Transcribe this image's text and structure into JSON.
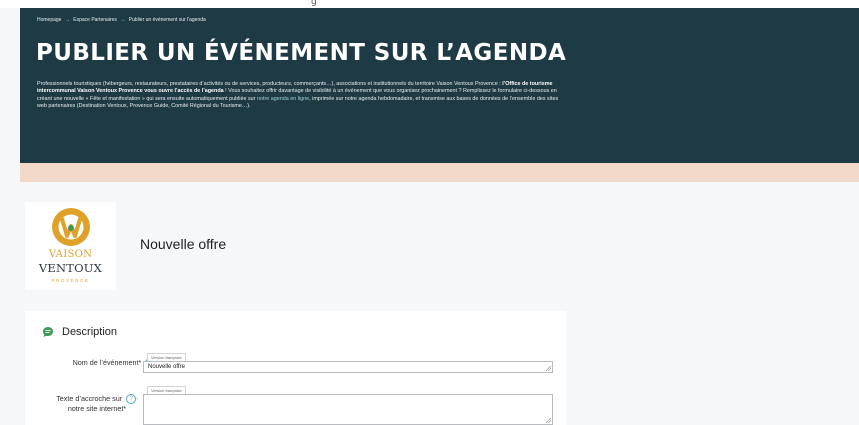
{
  "topstrip": {
    "glyph": "g"
  },
  "breadcrumb": [
    "Homepage",
    "→",
    "Espace Partenaires",
    "→",
    "Publier un événement sur l'agenda"
  ],
  "hero": {
    "title": "PUBLIER UN ÉVÉNEMENT SUR L’AGENDA",
    "intro_1": "Professionnels touristiques (hébergeurs, restaurateurs, prestataires d’activités ou de services, producteurs, commerçants…), associations et institutionnels du territoire Vaison Ventoux Provence : ",
    "intro_bold": "l’Office de tourisme intercommunal Vaison Ventoux Provence vous ouvre l’accès de l’agenda",
    "intro_2": " ! Vous souhaitez offrir davantage de visibilité à un événement que vous organisez prochainement ? Remplissez le formulaire ci-dessous en créant une nouvelle « Fête et manifestation » qui sera ensuite automatiquement publiée sur ",
    "intro_link": "notre agenda en ligne",
    "intro_3": ", imprimée sur notre agenda hebdomadaire, et transmise aux bases de données de l’ensemble des sites web partenaires (Destination Ventoux, Provence Guide, Comité Régional du Tourisme…)."
  },
  "logo": {
    "line1": "VAISON",
    "line2": "VENTOUX",
    "line3": "PROVENCE"
  },
  "offer": {
    "title": "Nouvelle offre"
  },
  "description": {
    "heading": "Description",
    "name_label": "Nom de l’événement",
    "name_tag": "Version française",
    "name_value": "Nouvelle offre",
    "hook_label_1": "Texte d’accroche sur",
    "hook_label_2": "notre site internet",
    "hook_tag": "Version française",
    "hook_value": ""
  },
  "colors": {
    "hero_bg": "#1e3a44",
    "peach": "#f3d9c7",
    "gold": "#e0a129",
    "green": "#3f9a5a"
  }
}
